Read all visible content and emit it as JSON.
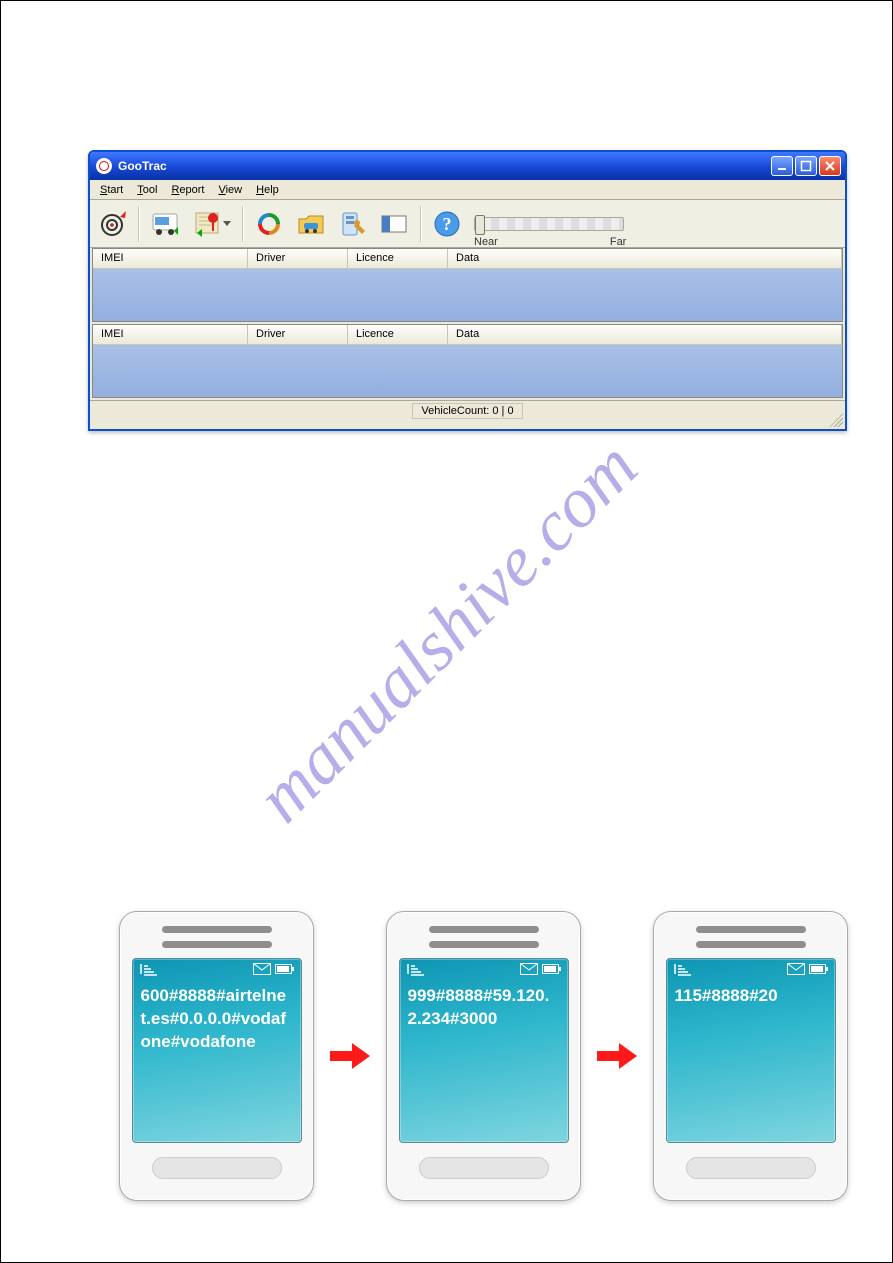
{
  "watermark": "manualshive.com",
  "window": {
    "title": "GooTrac",
    "menu": {
      "start": "Start",
      "tool": "Tool",
      "report": "Report",
      "view": "View",
      "help": "Help"
    },
    "toolbar_icons": {
      "target": "target-icon",
      "bus": "bus-map-icon",
      "map_pin": "map-pin-icon",
      "recycle": "recycle-icon",
      "car_folder": "car-folder-icon",
      "tools": "tools-icon",
      "split": "split-pane-icon",
      "help": "help-icon"
    },
    "slider": {
      "near": "Near",
      "far": "Far"
    },
    "columns": {
      "imei": "IMEI",
      "driver": "Driver",
      "licence": "Licence",
      "data": "Data"
    },
    "status": "VehicleCount: 0 | 0"
  },
  "phones": {
    "p1": "600#8888#airtelnet.es#0.0.0.0#vodafone#vodafone",
    "p2": "999#8888#59.120.2.234#3000",
    "p3": "115#8888#20"
  }
}
